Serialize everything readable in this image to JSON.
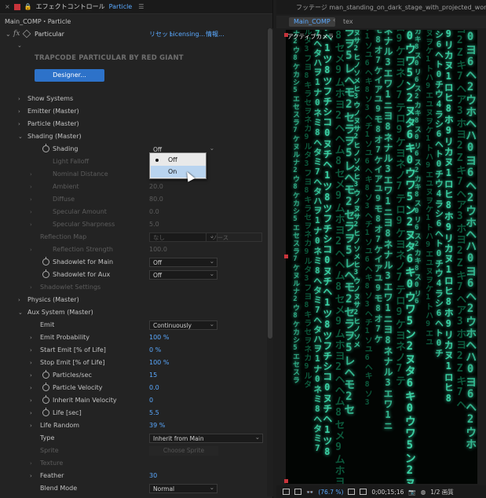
{
  "effect_controls": {
    "tab_title": "エフェクトコントロール",
    "tab_target": "Particle",
    "breadcrumb": "Main_COMP・Particle",
    "effect_name": "Particular",
    "reset_label": "リセット",
    "licensing_label": "Licensing...",
    "info_label": "情報...",
    "brand_title": "TRAPCODE PARTICULAR BY RED GIANT",
    "designer_label": "Designer...",
    "rows": [
      {
        "label": "Show Systems",
        "indent": 1,
        "twisty": "right"
      },
      {
        "label": "Emitter (Master)",
        "indent": 1,
        "twisty": "right"
      },
      {
        "label": "Particle (Master)",
        "indent": 1,
        "twisty": "right"
      },
      {
        "label": "Shading (Master)",
        "indent": 1,
        "twisty": "down"
      },
      {
        "label": "Shading",
        "indent": 3,
        "stopwatch": true,
        "dropdown": "Off",
        "dropdown_style": "flat"
      },
      {
        "label": "Light Falloff",
        "indent": 3,
        "dim": true
      },
      {
        "label": "Nominal Distance",
        "indent": 3,
        "dim": true,
        "twisty": "right"
      },
      {
        "label": "Ambient",
        "indent": 3,
        "dim": true,
        "twisty": "right",
        "value": "20.0"
      },
      {
        "label": "Diffuse",
        "indent": 3,
        "dim": true,
        "twisty": "right",
        "value": "80.0"
      },
      {
        "label": "Specular Amount",
        "indent": 3,
        "dim": true,
        "twisty": "right",
        "value": "0.0"
      },
      {
        "label": "Specular Sharpness",
        "indent": 3,
        "dim": true,
        "twisty": "right",
        "value": "5.0"
      },
      {
        "label": "Reflection Map",
        "indent": 2,
        "dim": true,
        "dropdown": "なし",
        "dropdown2": "ソース"
      },
      {
        "label": "Reflection Strength",
        "indent": 3,
        "dim": true,
        "twisty": "right",
        "value": "100.0"
      },
      {
        "label": "Shadowlet for Main",
        "indent": 3,
        "stopwatch": true,
        "dropdown": "Off"
      },
      {
        "label": "Shadowlet for Aux",
        "indent": 3,
        "stopwatch": true,
        "dropdown": "Off"
      },
      {
        "label": "Shadowlet Settings",
        "indent": 2,
        "dim": true,
        "twisty": "right"
      },
      {
        "label": "Physics (Master)",
        "indent": 1,
        "twisty": "right"
      },
      {
        "label": "Aux System (Master)",
        "indent": 1,
        "twisty": "down"
      },
      {
        "label": "Emit",
        "indent": 2,
        "dropdown": "Continuously"
      },
      {
        "label": "Emit Probability",
        "indent": 2,
        "twisty": "right",
        "value": "100 %"
      },
      {
        "label": "Start Emit [% of Life]",
        "indent": 2,
        "twisty": "right",
        "value": "0 %"
      },
      {
        "label": "Stop Emit [% of Life]",
        "indent": 2,
        "twisty": "right",
        "value": "100 %"
      },
      {
        "label": "Particles/sec",
        "indent": 3,
        "twisty": "right",
        "stopwatch": true,
        "value": "15"
      },
      {
        "label": "Particle Velocity",
        "indent": 3,
        "twisty": "right",
        "stopwatch": true,
        "value": "0.0"
      },
      {
        "label": "Inherit Main Velocity",
        "indent": 3,
        "twisty": "right",
        "stopwatch": true,
        "value": "0"
      },
      {
        "label": "Life [sec]",
        "indent": 3,
        "twisty": "right",
        "stopwatch": true,
        "value": "5.5"
      },
      {
        "label": "Life Random",
        "indent": 2,
        "twisty": "right",
        "value": "39 %"
      },
      {
        "label": "Type",
        "indent": 2,
        "dropdown": "Inherit from Main",
        "dropdown_style": "wide"
      },
      {
        "label": "Sprite",
        "indent": 2,
        "dim": true,
        "button": "Choose Sprite"
      },
      {
        "label": "Texture",
        "indent": 2,
        "dim": true,
        "twisty": "right"
      },
      {
        "label": "Feather",
        "indent": 2,
        "twisty": "right",
        "value": "30"
      },
      {
        "label": "Blend Mode",
        "indent": 2,
        "dropdown": "Normal"
      }
    ],
    "popup": {
      "options": [
        "Off",
        "On"
      ],
      "checked": "Off",
      "hovered": "On"
    }
  },
  "footage": {
    "tab_title": "フッテージ man_standing_on_dark_stage_with_projected_words_behind",
    "comp_tab": "Main_COMP",
    "other_tab": "tex",
    "camera_label": "アクティブカメラ",
    "zoom": "(76.7 %)",
    "timecode": "0;00;15;16",
    "resolution": "1/2 画質"
  },
  "rain": [
    "ナ2ウ8ケカシ5エセスラ7ケヌル",
    "ネカ9ルタ3フヨ8キラセヲ",
    "ミ7ヘタハヲ1ナ0ネミ8ヘタ",
    "コ0ヌチヘ1ツ8ツフチシ",
    "ヘム8セメ9ムホヨ2ヘ",
    "ラヲ5レヘモ2セ",
    "ヒ3ウノヌサ2ヒノソメ",
    "ヘチ1ソユ6ヘキ8ソ3",
    "イアユ9モ8オ7ケ",
    "ヨ8ネナル3エワ1ニ",
    "ロ9ケヨネノ7テ",
    "タ6キ0ウワ5ン2ヌ",
    "ス2カキ8ス0リ6",
    "ヌヲケ1トハ9エユ",
    "ウ4ラシ6ヘト0チ",
    "ホ9リカヌ1ロヒ8",
    "ア3ホヨ2Zキ7ヘ",
    "ヘハ0ヨ6ヘ2ウホ"
  ],
  "colors": {
    "accent_blue": "#5aa9ff",
    "rain_bright": "#3fe0b0",
    "rain_dim": "#0f6d4a",
    "marker_red": "#c8343b"
  }
}
